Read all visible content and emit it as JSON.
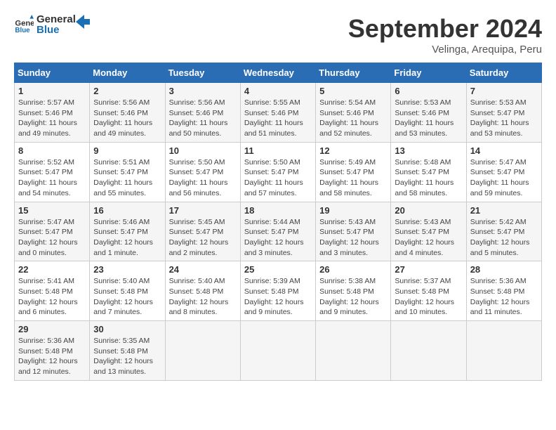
{
  "header": {
    "logo_line1": "General",
    "logo_line2": "Blue",
    "month_title": "September 2024",
    "location": "Velinga, Arequipa, Peru"
  },
  "days_of_week": [
    "Sunday",
    "Monday",
    "Tuesday",
    "Wednesday",
    "Thursday",
    "Friday",
    "Saturday"
  ],
  "weeks": [
    [
      {
        "day": "1",
        "sunrise": "5:57 AM",
        "sunset": "5:46 PM",
        "daylight": "11 hours and 49 minutes."
      },
      {
        "day": "2",
        "sunrise": "5:56 AM",
        "sunset": "5:46 PM",
        "daylight": "11 hours and 49 minutes."
      },
      {
        "day": "3",
        "sunrise": "5:56 AM",
        "sunset": "5:46 PM",
        "daylight": "11 hours and 50 minutes."
      },
      {
        "day": "4",
        "sunrise": "5:55 AM",
        "sunset": "5:46 PM",
        "daylight": "11 hours and 51 minutes."
      },
      {
        "day": "5",
        "sunrise": "5:54 AM",
        "sunset": "5:46 PM",
        "daylight": "11 hours and 52 minutes."
      },
      {
        "day": "6",
        "sunrise": "5:53 AM",
        "sunset": "5:46 PM",
        "daylight": "11 hours and 53 minutes."
      },
      {
        "day": "7",
        "sunrise": "5:53 AM",
        "sunset": "5:47 PM",
        "daylight": "11 hours and 53 minutes."
      }
    ],
    [
      {
        "day": "8",
        "sunrise": "5:52 AM",
        "sunset": "5:47 PM",
        "daylight": "11 hours and 54 minutes."
      },
      {
        "day": "9",
        "sunrise": "5:51 AM",
        "sunset": "5:47 PM",
        "daylight": "11 hours and 55 minutes."
      },
      {
        "day": "10",
        "sunrise": "5:50 AM",
        "sunset": "5:47 PM",
        "daylight": "11 hours and 56 minutes."
      },
      {
        "day": "11",
        "sunrise": "5:50 AM",
        "sunset": "5:47 PM",
        "daylight": "11 hours and 57 minutes."
      },
      {
        "day": "12",
        "sunrise": "5:49 AM",
        "sunset": "5:47 PM",
        "daylight": "11 hours and 58 minutes."
      },
      {
        "day": "13",
        "sunrise": "5:48 AM",
        "sunset": "5:47 PM",
        "daylight": "11 hours and 58 minutes."
      },
      {
        "day": "14",
        "sunrise": "5:47 AM",
        "sunset": "5:47 PM",
        "daylight": "11 hours and 59 minutes."
      }
    ],
    [
      {
        "day": "15",
        "sunrise": "5:47 AM",
        "sunset": "5:47 PM",
        "daylight": "12 hours and 0 minutes."
      },
      {
        "day": "16",
        "sunrise": "5:46 AM",
        "sunset": "5:47 PM",
        "daylight": "12 hours and 1 minute."
      },
      {
        "day": "17",
        "sunrise": "5:45 AM",
        "sunset": "5:47 PM",
        "daylight": "12 hours and 2 minutes."
      },
      {
        "day": "18",
        "sunrise": "5:44 AM",
        "sunset": "5:47 PM",
        "daylight": "12 hours and 3 minutes."
      },
      {
        "day": "19",
        "sunrise": "5:43 AM",
        "sunset": "5:47 PM",
        "daylight": "12 hours and 3 minutes."
      },
      {
        "day": "20",
        "sunrise": "5:43 AM",
        "sunset": "5:47 PM",
        "daylight": "12 hours and 4 minutes."
      },
      {
        "day": "21",
        "sunrise": "5:42 AM",
        "sunset": "5:47 PM",
        "daylight": "12 hours and 5 minutes."
      }
    ],
    [
      {
        "day": "22",
        "sunrise": "5:41 AM",
        "sunset": "5:48 PM",
        "daylight": "12 hours and 6 minutes."
      },
      {
        "day": "23",
        "sunrise": "5:40 AM",
        "sunset": "5:48 PM",
        "daylight": "12 hours and 7 minutes."
      },
      {
        "day": "24",
        "sunrise": "5:40 AM",
        "sunset": "5:48 PM",
        "daylight": "12 hours and 8 minutes."
      },
      {
        "day": "25",
        "sunrise": "5:39 AM",
        "sunset": "5:48 PM",
        "daylight": "12 hours and 9 minutes."
      },
      {
        "day": "26",
        "sunrise": "5:38 AM",
        "sunset": "5:48 PM",
        "daylight": "12 hours and 9 minutes."
      },
      {
        "day": "27",
        "sunrise": "5:37 AM",
        "sunset": "5:48 PM",
        "daylight": "12 hours and 10 minutes."
      },
      {
        "day": "28",
        "sunrise": "5:36 AM",
        "sunset": "5:48 PM",
        "daylight": "12 hours and 11 minutes."
      }
    ],
    [
      {
        "day": "29",
        "sunrise": "5:36 AM",
        "sunset": "5:48 PM",
        "daylight": "12 hours and 12 minutes."
      },
      {
        "day": "30",
        "sunrise": "5:35 AM",
        "sunset": "5:48 PM",
        "daylight": "12 hours and 13 minutes."
      },
      null,
      null,
      null,
      null,
      null
    ]
  ],
  "labels": {
    "sunrise": "Sunrise:",
    "sunset": "Sunset:",
    "daylight": "Daylight:"
  }
}
